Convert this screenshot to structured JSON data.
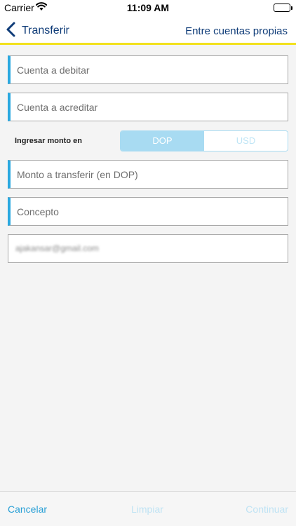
{
  "status_bar": {
    "carrier": "Carrier",
    "time": "11:09 AM"
  },
  "nav": {
    "back_label": "Transferir",
    "title": "Entre cuentas propias"
  },
  "form": {
    "debit_account_placeholder": "Cuenta a debitar",
    "credit_account_placeholder": "Cuenta a acreditar",
    "currency_label": "Ingresar monto en",
    "currency_options": [
      "DOP",
      "USD"
    ],
    "currency_selected": "DOP",
    "amount_placeholder": "Monto a transferir (en DOP)",
    "concept_placeholder": "Concepto",
    "email_value": "ajakansar@gmail.com"
  },
  "bottom_bar": {
    "cancel_label": "Cancelar",
    "clear_label": "Limpiar",
    "continue_label": "Continuar"
  },
  "colors": {
    "nav_text": "#0f3c78",
    "accent_yellow": "#f2e11d",
    "accent_blue": "#29a8e0",
    "segment_active": "#a8dbf2",
    "disabled_text": "#bfe3f4"
  }
}
